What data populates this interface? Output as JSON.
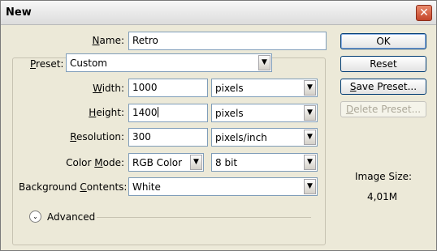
{
  "window": {
    "title": "New",
    "close_glyph": "✕"
  },
  "form": {
    "name": {
      "label_u": "N",
      "label_rest": "ame:",
      "value": "Retro"
    },
    "preset": {
      "label_u": "P",
      "label_rest": "reset:",
      "value": "Custom"
    },
    "width": {
      "label_u": "W",
      "label_rest": "idth:",
      "value": "1000",
      "unit": "pixels"
    },
    "height": {
      "label_u": "H",
      "label_rest": "eight:",
      "value": "1400",
      "unit": "pixels"
    },
    "resolution": {
      "label_u": "R",
      "label_rest": "esolution:",
      "value": "300",
      "unit": "pixels/inch"
    },
    "color_mode": {
      "label_pre": "Color ",
      "label_u": "M",
      "label_rest": "ode:",
      "value": "RGB Color",
      "depth": "8 bit"
    },
    "background": {
      "label_pre": "Background ",
      "label_u": "C",
      "label_rest": "ontents:",
      "value": "White"
    },
    "advanced": {
      "label": "Advanced"
    }
  },
  "buttons": {
    "ok": "OK",
    "reset": "Reset",
    "save_u": "S",
    "save_rest": "ave Preset...",
    "delete_u": "D",
    "delete_rest": "elete Preset..."
  },
  "image_size": {
    "label": "Image Size:",
    "value": "4,01M"
  },
  "icons": {
    "dropdown": "chevron-down-icon",
    "advanced": "expand-circle-icon",
    "close": "close-icon"
  },
  "colors": {
    "dialog_bg": "#ece9d8",
    "field_border": "#7f9db9",
    "close_red": "#c4452a"
  }
}
